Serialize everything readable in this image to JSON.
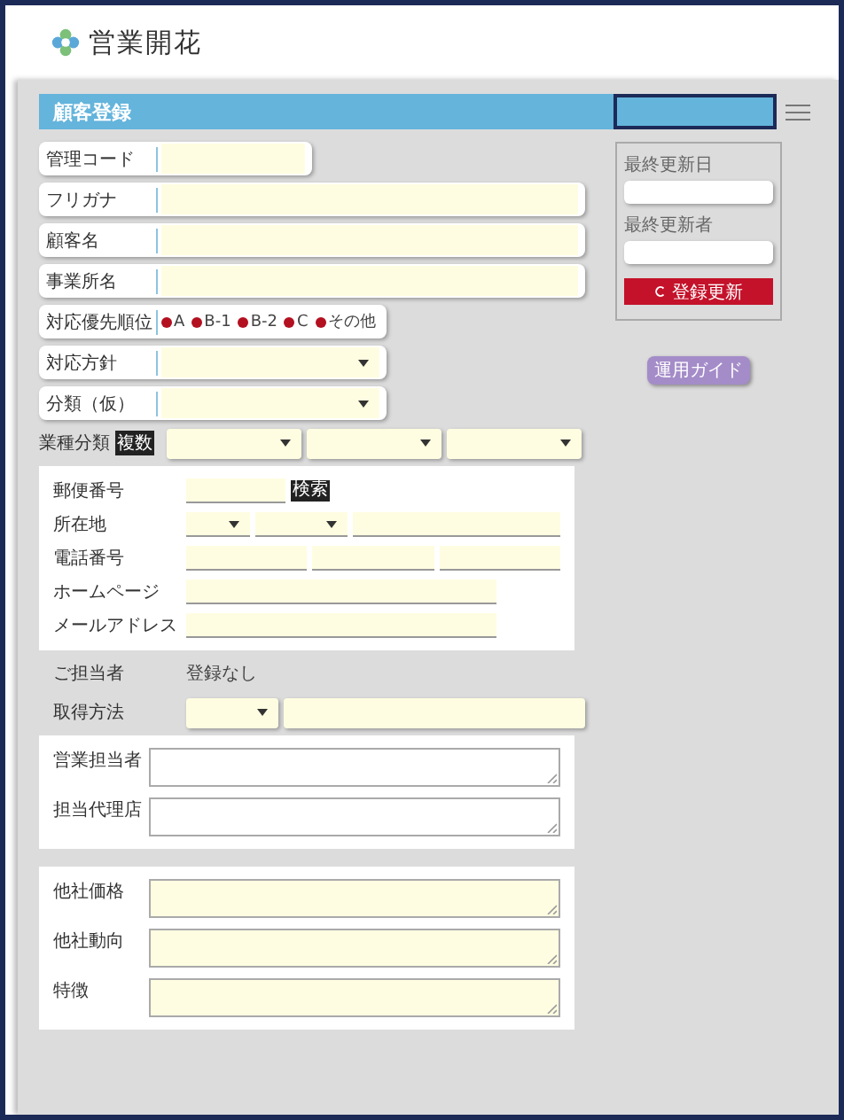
{
  "logo": {
    "text": "営業開花"
  },
  "title_bar": {
    "title": "顧客登録"
  },
  "fields": [
    {
      "kind": "short",
      "label": "管理コード"
    },
    {
      "kind": "text",
      "label": "フリガナ"
    },
    {
      "kind": "text",
      "label": "顧客名"
    },
    {
      "kind": "text",
      "label": "事業所名"
    },
    {
      "kind": "radio",
      "label": "対応優先順位",
      "options": [
        "A",
        "B-1",
        "B-2",
        "C",
        "その他"
      ]
    },
    {
      "kind": "select",
      "label": "対応方針"
    },
    {
      "kind": "select",
      "label": "分類（仮）"
    }
  ],
  "industry": {
    "label": "業種分類",
    "badge": "複数",
    "selects": [
      {
        "kind": "select"
      },
      {
        "kind": "select"
      },
      {
        "kind": "select"
      }
    ]
  },
  "address": [
    {
      "kind": "zip",
      "label": "郵便番号",
      "button": "検索"
    },
    {
      "kind": "location",
      "label": "所在地"
    },
    {
      "kind": "phone",
      "label": "電話番号"
    },
    {
      "kind": "wide",
      "label": "ホームページ"
    },
    {
      "kind": "wide",
      "label": "メールアドレス"
    }
  ],
  "contact": {
    "label": "ご担当者",
    "value": "登録なし"
  },
  "acquisition": {
    "label": "取得方法"
  },
  "panels": [
    {
      "kind": "plain",
      "fields": [
        "営業担当者",
        "担当代理店"
      ]
    },
    {
      "kind": "highlight",
      "fields": [
        "他社価格",
        "他社動向",
        "特徴"
      ]
    }
  ],
  "side": {
    "fields": [
      "最終更新日",
      "最終更新者"
    ],
    "update_button": "登録更新",
    "guide_button": "運用ガイド"
  }
}
